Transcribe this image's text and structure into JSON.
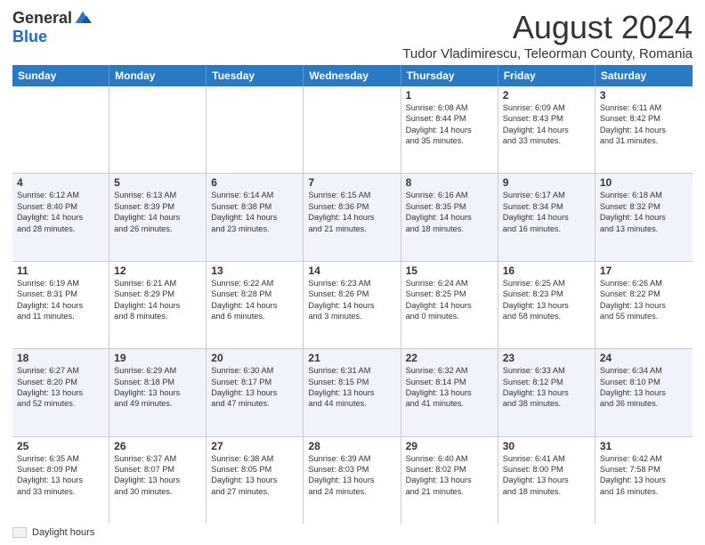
{
  "logo": {
    "general": "General",
    "blue": "Blue"
  },
  "title": "August 2024",
  "subtitle": "Tudor Vladimirescu, Teleorman County, Romania",
  "days": [
    "Sunday",
    "Monday",
    "Tuesday",
    "Wednesday",
    "Thursday",
    "Friday",
    "Saturday"
  ],
  "weeks": [
    [
      {
        "day": "",
        "info": ""
      },
      {
        "day": "",
        "info": ""
      },
      {
        "day": "",
        "info": ""
      },
      {
        "day": "",
        "info": ""
      },
      {
        "day": "1",
        "info": "Sunrise: 6:08 AM\nSunset: 8:44 PM\nDaylight: 14 hours\nand 35 minutes."
      },
      {
        "day": "2",
        "info": "Sunrise: 6:09 AM\nSunset: 8:43 PM\nDaylight: 14 hours\nand 33 minutes."
      },
      {
        "day": "3",
        "info": "Sunrise: 6:11 AM\nSunset: 8:42 PM\nDaylight: 14 hours\nand 31 minutes."
      }
    ],
    [
      {
        "day": "4",
        "info": "Sunrise: 6:12 AM\nSunset: 8:40 PM\nDaylight: 14 hours\nand 28 minutes."
      },
      {
        "day": "5",
        "info": "Sunrise: 6:13 AM\nSunset: 8:39 PM\nDaylight: 14 hours\nand 26 minutes."
      },
      {
        "day": "6",
        "info": "Sunrise: 6:14 AM\nSunset: 8:38 PM\nDaylight: 14 hours\nand 23 minutes."
      },
      {
        "day": "7",
        "info": "Sunrise: 6:15 AM\nSunset: 8:36 PM\nDaylight: 14 hours\nand 21 minutes."
      },
      {
        "day": "8",
        "info": "Sunrise: 6:16 AM\nSunset: 8:35 PM\nDaylight: 14 hours\nand 18 minutes."
      },
      {
        "day": "9",
        "info": "Sunrise: 6:17 AM\nSunset: 8:34 PM\nDaylight: 14 hours\nand 16 minutes."
      },
      {
        "day": "10",
        "info": "Sunrise: 6:18 AM\nSunset: 8:32 PM\nDaylight: 14 hours\nand 13 minutes."
      }
    ],
    [
      {
        "day": "11",
        "info": "Sunrise: 6:19 AM\nSunset: 8:31 PM\nDaylight: 14 hours\nand 11 minutes."
      },
      {
        "day": "12",
        "info": "Sunrise: 6:21 AM\nSunset: 8:29 PM\nDaylight: 14 hours\nand 8 minutes."
      },
      {
        "day": "13",
        "info": "Sunrise: 6:22 AM\nSunset: 8:28 PM\nDaylight: 14 hours\nand 6 minutes."
      },
      {
        "day": "14",
        "info": "Sunrise: 6:23 AM\nSunset: 8:26 PM\nDaylight: 14 hours\nand 3 minutes."
      },
      {
        "day": "15",
        "info": "Sunrise: 6:24 AM\nSunset: 8:25 PM\nDaylight: 14 hours\nand 0 minutes."
      },
      {
        "day": "16",
        "info": "Sunrise: 6:25 AM\nSunset: 8:23 PM\nDaylight: 13 hours\nand 58 minutes."
      },
      {
        "day": "17",
        "info": "Sunrise: 6:26 AM\nSunset: 8:22 PM\nDaylight: 13 hours\nand 55 minutes."
      }
    ],
    [
      {
        "day": "18",
        "info": "Sunrise: 6:27 AM\nSunset: 8:20 PM\nDaylight: 13 hours\nand 52 minutes."
      },
      {
        "day": "19",
        "info": "Sunrise: 6:29 AM\nSunset: 8:18 PM\nDaylight: 13 hours\nand 49 minutes."
      },
      {
        "day": "20",
        "info": "Sunrise: 6:30 AM\nSunset: 8:17 PM\nDaylight: 13 hours\nand 47 minutes."
      },
      {
        "day": "21",
        "info": "Sunrise: 6:31 AM\nSunset: 8:15 PM\nDaylight: 13 hours\nand 44 minutes."
      },
      {
        "day": "22",
        "info": "Sunrise: 6:32 AM\nSunset: 8:14 PM\nDaylight: 13 hours\nand 41 minutes."
      },
      {
        "day": "23",
        "info": "Sunrise: 6:33 AM\nSunset: 8:12 PM\nDaylight: 13 hours\nand 38 minutes."
      },
      {
        "day": "24",
        "info": "Sunrise: 6:34 AM\nSunset: 8:10 PM\nDaylight: 13 hours\nand 36 minutes."
      }
    ],
    [
      {
        "day": "25",
        "info": "Sunrise: 6:35 AM\nSunset: 8:09 PM\nDaylight: 13 hours\nand 33 minutes."
      },
      {
        "day": "26",
        "info": "Sunrise: 6:37 AM\nSunset: 8:07 PM\nDaylight: 13 hours\nand 30 minutes."
      },
      {
        "day": "27",
        "info": "Sunrise: 6:38 AM\nSunset: 8:05 PM\nDaylight: 13 hours\nand 27 minutes."
      },
      {
        "day": "28",
        "info": "Sunrise: 6:39 AM\nSunset: 8:03 PM\nDaylight: 13 hours\nand 24 minutes."
      },
      {
        "day": "29",
        "info": "Sunrise: 6:40 AM\nSunset: 8:02 PM\nDaylight: 13 hours\nand 21 minutes."
      },
      {
        "day": "30",
        "info": "Sunrise: 6:41 AM\nSunset: 8:00 PM\nDaylight: 13 hours\nand 18 minutes."
      },
      {
        "day": "31",
        "info": "Sunrise: 6:42 AM\nSunset: 7:58 PM\nDaylight: 13 hours\nand 16 minutes."
      }
    ]
  ],
  "footer": {
    "label": "Daylight hours"
  }
}
